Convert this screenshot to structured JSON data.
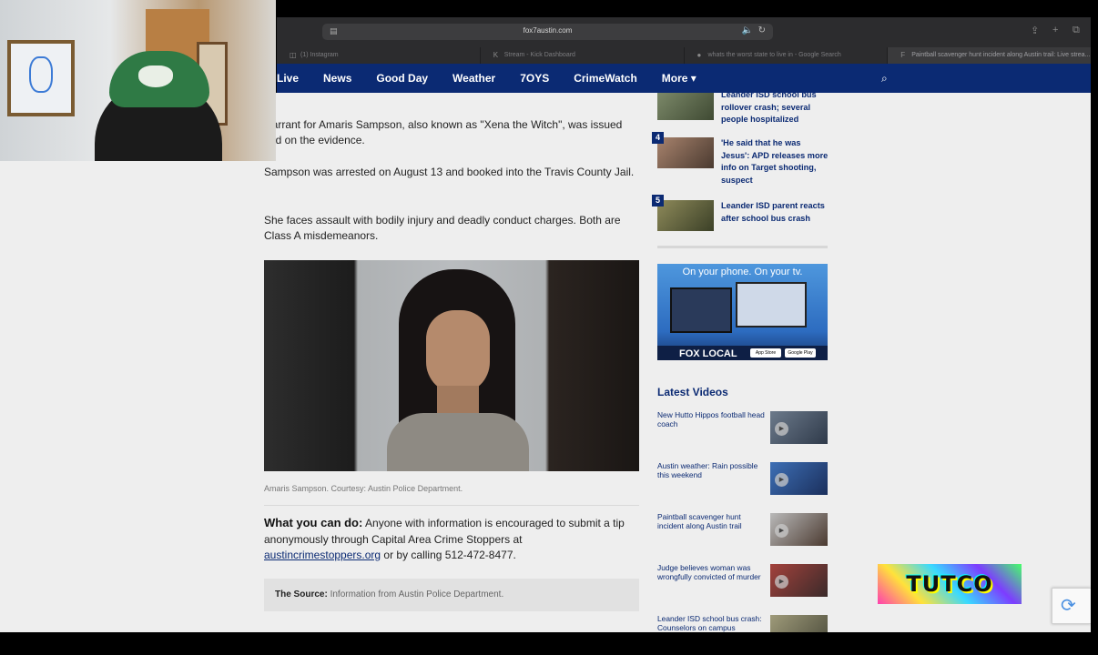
{
  "browser": {
    "url": "fox7austin.com",
    "tabs": [
      {
        "label": "(1) Instagram",
        "icon": "◫"
      },
      {
        "label": "Stream - Kick Dashboard",
        "icon": "K"
      },
      {
        "label": "whats the worst state to live in - Google Search",
        "icon": "●"
      },
      {
        "label": "Paintball scavenger hunt incident along Austin trail: Live strea...",
        "icon": "F"
      }
    ]
  },
  "nav": {
    "items": [
      "Live",
      "News",
      "Good Day",
      "Weather",
      "7OYS",
      "CrimeWatch",
      "More ▾"
    ]
  },
  "article": {
    "para1": "warrant for Amaris Sampson, also known as \"Xena the Witch\", was issued sed on the evidence.",
    "para2": "Sampson was arrested on August 13 and booked into the Travis County Jail.",
    "para3": "She faces assault with bodily injury and deadly conduct charges. Both are Class A misdemeanors.",
    "caption": "Amaris Sampson. Courtesy: Austin Police Department.",
    "tip_heading": "What you can do:",
    "tip_body": "Anyone with information is encouraged to submit a tip anonymously through Capital Area Crime Stoppers at",
    "tip_link": "austincrimestoppers.org",
    "tip_tail": "or by calling 512-472-8477.",
    "source_label": "The Source:",
    "source_text": "Information from Austin Police Department."
  },
  "sidebar": {
    "trending": [
      {
        "num": "",
        "title": "Leander ISD school bus rollover crash; several people hospitalized"
      },
      {
        "num": "4",
        "title": "'He said that he was Jesus': APD releases more info on Target shooting, suspect"
      },
      {
        "num": "5",
        "title": "Leander ISD parent reacts after school bus crash"
      }
    ],
    "promo": {
      "text": "On your phone. On your tv.",
      "brand": "FOX LOCAL",
      "app_store": "App Store",
      "google_play": "Google Play"
    },
    "latest_title": "Latest Videos",
    "videos": [
      {
        "title": "New Hutto Hippos football head coach"
      },
      {
        "title": "Austin weather: Rain possible this weekend"
      },
      {
        "title": "Paintball scavenger hunt incident along Austin trail"
      },
      {
        "title": "Judge believes woman was wrongfully convicted of murder"
      },
      {
        "title": "Leander ISD school bus crash: Counselors on campus"
      }
    ]
  },
  "overlay": {
    "logo_text": "TUTCO"
  },
  "colors": {
    "nav_bg": "#0b2a73",
    "link": "#0b2a73",
    "page_bg": "#eeeeee"
  }
}
